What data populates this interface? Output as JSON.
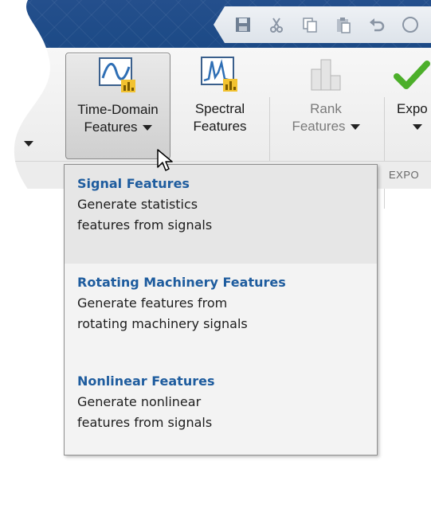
{
  "ribbon": {
    "buttons": [
      {
        "line1": "Time-Domain",
        "line2": "Features",
        "has_menu": true,
        "state": "active"
      },
      {
        "line1": "Spectral",
        "line2": "Features",
        "has_menu": false,
        "state": "normal"
      },
      {
        "line1": "Rank",
        "line2": "Features",
        "has_menu": true,
        "state": "disabled"
      },
      {
        "line1": "Expo",
        "line2": "",
        "has_menu": true,
        "state": "normal"
      }
    ],
    "section_label": "EXPO"
  },
  "quick_access": {
    "icons": [
      "save-icon",
      "cut-icon",
      "copy-icon",
      "paste-icon",
      "undo-icon",
      "help-icon"
    ]
  },
  "menu": {
    "items": [
      {
        "title": "Signal Features",
        "desc1": "Generate statistics",
        "desc2": "features from signals"
      },
      {
        "title": "Rotating Machinery Features",
        "desc1": "Generate features from",
        "desc2": "rotating machinery signals"
      },
      {
        "title": "Nonlinear Features",
        "desc1": "Generate nonlinear",
        "desc2": "features from signals"
      }
    ]
  },
  "colors": {
    "accent": "#1e5c9e",
    "titlebar": "#1f4f8f",
    "check": "#4caf2a"
  }
}
